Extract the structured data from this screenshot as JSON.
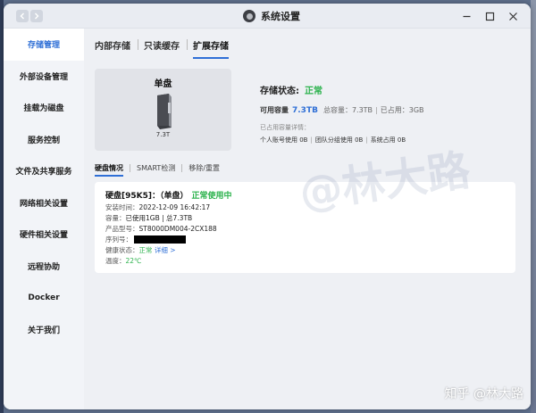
{
  "window": {
    "title": "系统设置"
  },
  "sidebar": {
    "items": [
      {
        "label": "存储管理",
        "active": true
      },
      {
        "label": "外部设备管理"
      },
      {
        "label": "挂载为磁盘"
      },
      {
        "label": "服务控制"
      },
      {
        "label": "文件及共享服务"
      },
      {
        "label": "网络相关设置"
      },
      {
        "label": "硬件相关设置"
      },
      {
        "label": "远程协助"
      },
      {
        "label": "Docker"
      },
      {
        "label": "关于我们"
      }
    ]
  },
  "tabs": [
    {
      "label": "内部存储"
    },
    {
      "label": "只读缓存"
    },
    {
      "label": "扩展存储",
      "active": true
    }
  ],
  "disk_card": {
    "title": "单盘",
    "size": "7.3T"
  },
  "storage": {
    "status_label": "存储状态:",
    "status_value": "正常",
    "available_label": "可用容量",
    "available_value": "7.3TB",
    "total": "总容量：7.3TB",
    "used": "已占用：3GB",
    "detail_title": "已占用容量详情：",
    "detail_personal": "个人账号使用 0B",
    "detail_team": "团队分组使用 0B",
    "detail_system": "系统占用 0B"
  },
  "subtabs": [
    {
      "label": "硬盘情况",
      "active": true
    },
    {
      "label": "SMART检测"
    },
    {
      "label": "移除/重置"
    }
  ],
  "disk_info": {
    "title": "硬盘[95K5]：（单盘）",
    "status": "正常使用中",
    "install_label": "安装时间：",
    "install_value": "2022-12-09 16:42:17",
    "capacity_label": "容量：",
    "capacity_value": "已使用1GB | 总7.3TB",
    "model_label": "产品型号：",
    "model_value": "ST8000DM004-2CX188",
    "serial_label": "序列号：",
    "health_label": "健康状态：",
    "health_value": "正常",
    "health_link": "详细 >",
    "temp_label": "温度：",
    "temp_value": "22℃"
  },
  "watermark": {
    "center": "@林大路",
    "corner": "知乎 @林大路"
  },
  "colors": {
    "accent": "#2f6fd6",
    "ok": "#2bb24c"
  }
}
